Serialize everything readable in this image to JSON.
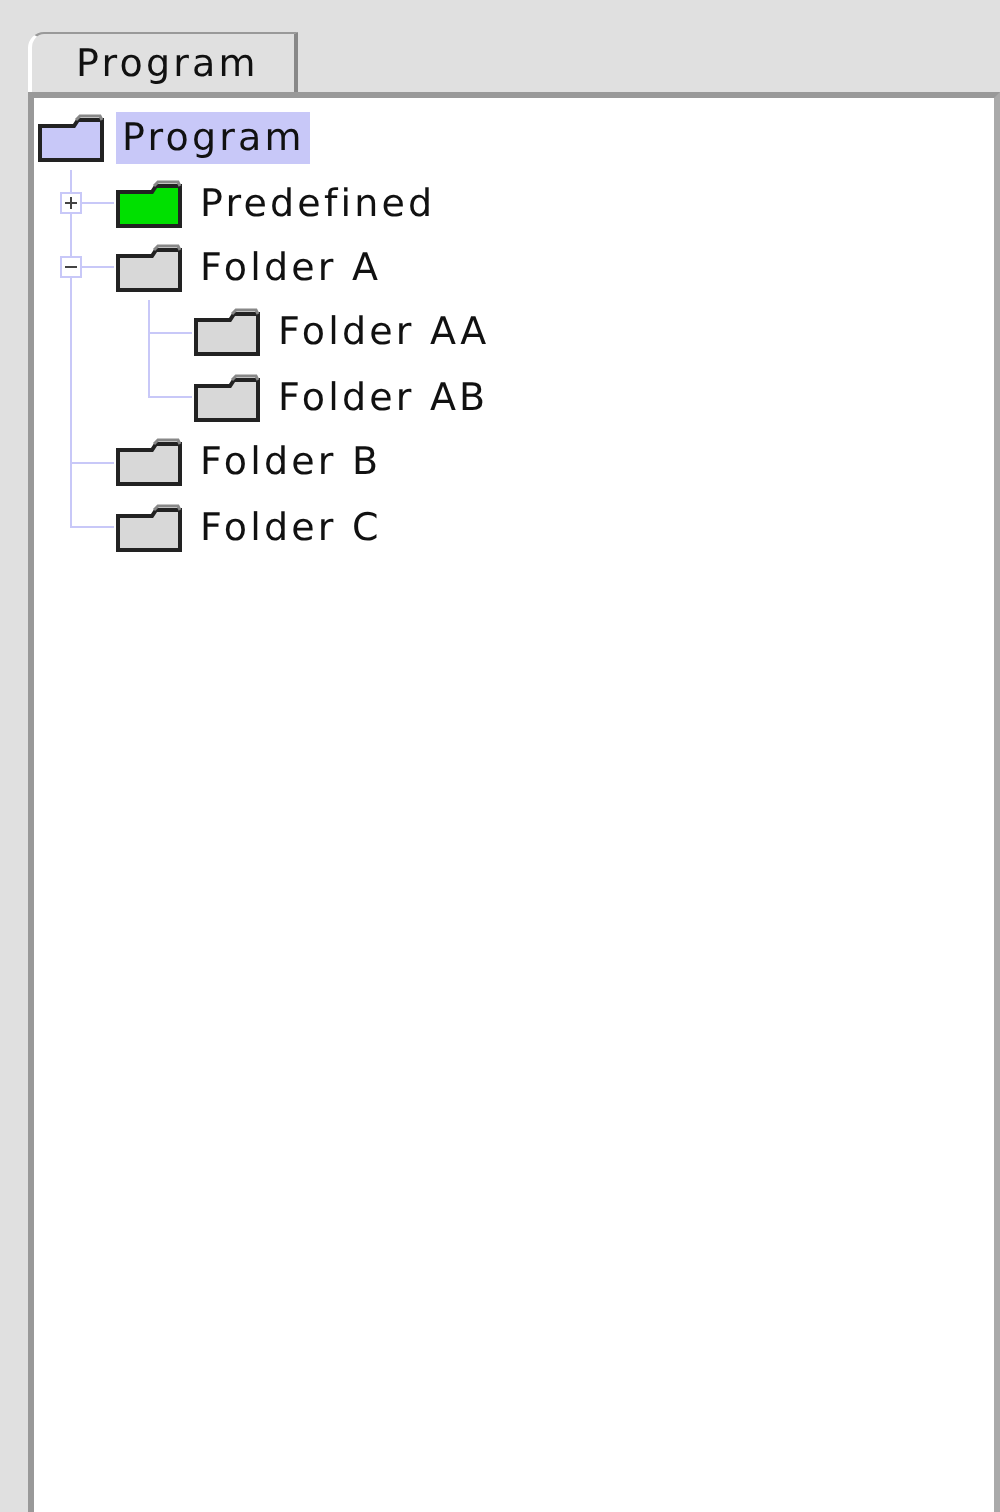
{
  "tabs": [
    {
      "label": "Program",
      "selected": true
    }
  ],
  "tree": [
    {
      "label": "Program",
      "selected": true,
      "color": "#c8c8f8",
      "children": [
        {
          "label": "Predefined",
          "selected": false,
          "color": "#00e000",
          "expanded": false
        },
        {
          "label": "Folder A",
          "selected": false,
          "color": "#d8d8d8",
          "expanded": true,
          "children": [
            {
              "label": "Folder AA",
              "selected": false,
              "color": "#d8d8d8"
            },
            {
              "label": "Folder AB",
              "selected": false,
              "color": "#d8d8d8"
            }
          ]
        },
        {
          "label": "Folder B",
          "selected": false,
          "color": "#d8d8d8"
        },
        {
          "label": "Folder C",
          "selected": false,
          "color": "#d8d8d8"
        }
      ]
    }
  ]
}
